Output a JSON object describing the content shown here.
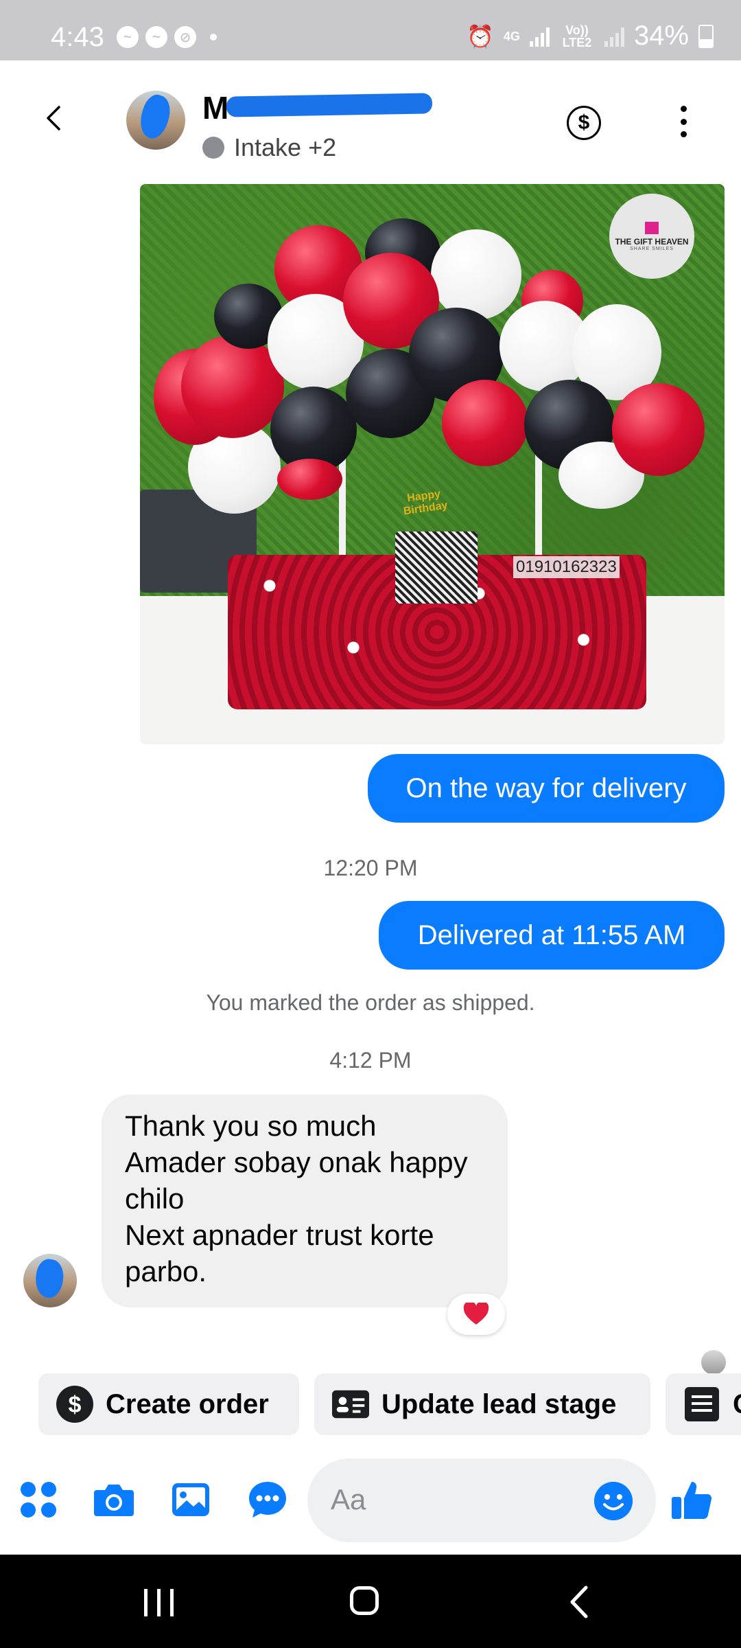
{
  "status_bar": {
    "time": "4:43",
    "network_type": "4G",
    "volte_label": "Vo)) LTE2",
    "battery": "34%"
  },
  "header": {
    "contact_name": "M",
    "contact_subtitle": "Intake +2",
    "status_dot_color": "#8a8d91",
    "icons": [
      "back-arrow-icon",
      "dollar-icon",
      "more-vertical-icon"
    ]
  },
  "photo": {
    "logo_title": "THE GIFT HEAVEN",
    "logo_tagline": "SHARE SMILES",
    "phone_overlay": "01910162323",
    "topper_text": "Happy Birthday"
  },
  "messages": {
    "outgoing_1": "On the way for delivery",
    "timestamp_1": "12:20 PM",
    "outgoing_2": "Delivered at 11:55 AM",
    "system_message": "You marked the order as shipped.",
    "timestamp_2": "4:12 PM",
    "incoming_lines": [
      "Thank you so much",
      "Amader sobay onak happy",
      "chilo",
      "Next apnader trust korte",
      "parbo."
    ],
    "reaction": "heart"
  },
  "actions": {
    "create_order": "Create order",
    "update_lead_stage": "Update lead stage",
    "third_chip_partial": "C"
  },
  "composer": {
    "placeholder": "Aa",
    "icons": [
      "apps-icon",
      "camera-icon",
      "gallery-icon",
      "chat-bubble-icon",
      "emoji-icon",
      "like-icon"
    ]
  },
  "colors": {
    "accent": "#0a7cff",
    "status_bar": "#c9c9cd",
    "incoming_bubble": "#f0f0f0",
    "heart": "#e41e3f"
  }
}
